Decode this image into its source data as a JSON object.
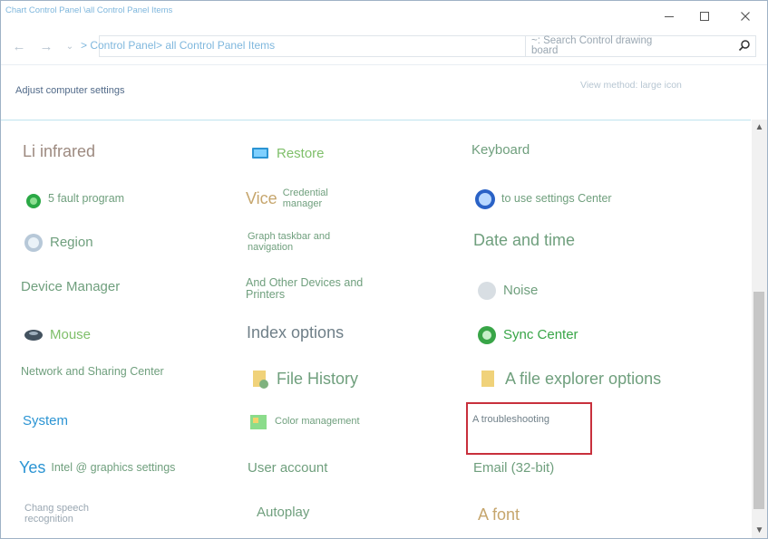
{
  "window": {
    "title": "Chart Control Panel \\all Control Panel Items"
  },
  "nav": {
    "address": "> Control Panel> all Control Panel Items",
    "search_placeholder": "~: Search Control drawing board"
  },
  "header": {
    "left": "Adjust computer settings",
    "right": "View method: large icon"
  },
  "items": [
    {
      "label": "Li infrared",
      "color": "#9d8a80",
      "size": "lg",
      "icon": "infrared-icon"
    },
    {
      "label": "Restore",
      "color": "#7fbf6a",
      "size": "md",
      "icon": "restore-icon"
    },
    {
      "label": "Keyboard",
      "color": "#6f9f7d",
      "size": "md",
      "icon": "keyboard-icon"
    },
    {
      "label": "5 fault program",
      "color": "#6f9f7d",
      "size": "sm",
      "icon": "default-programs-icon"
    },
    {
      "label": "Vice",
      "color": "#c6a66d",
      "size": "lg",
      "icon": "credential-manager-icon"
    },
    {
      "label": "Credential manager",
      "color": "#6f9f7d",
      "size": "xs",
      "icon": "credential-manager-icon"
    },
    {
      "label": "to use settings Center",
      "color": "#6f9f7d",
      "size": "sm",
      "icon": "ease-of-access-icon"
    },
    {
      "label": "Region",
      "color": "#6f9f7d",
      "size": "md",
      "icon": "region-icon"
    },
    {
      "label": "Graph taskbar and navigation",
      "color": "#6f9f7d",
      "size": "xs",
      "icon": "taskbar-icon"
    },
    {
      "label": "Date and time",
      "color": "#6f9f7d",
      "size": "lg",
      "icon": "date-time-icon"
    },
    {
      "label": "Device Manager",
      "color": "#6f9f7d",
      "size": "md",
      "icon": "device-manager-icon"
    },
    {
      "label": "And Other Devices and Printers",
      "color": "#6f9f7d",
      "size": "sm",
      "icon": "printers-icon"
    },
    {
      "label": "Noise",
      "color": "#6f9f7d",
      "size": "md",
      "icon": "sound-icon"
    },
    {
      "label": "Mouse",
      "color": "#7fbf6a",
      "size": "md",
      "icon": "mouse-icon"
    },
    {
      "label": "Index options",
      "color": "#6f7f88",
      "size": "lg",
      "icon": "index-options-icon"
    },
    {
      "label": "Sync Center",
      "color": "#38a547",
      "size": "md",
      "icon": "sync-center-icon"
    },
    {
      "label": "Network and Sharing Center",
      "color": "#6f9f7d",
      "size": "sm",
      "icon": "network-sharing-icon"
    },
    {
      "label": "File History",
      "color": "#6f9f7d",
      "size": "lg",
      "icon": "file-history-icon"
    },
    {
      "label": "A file explorer options",
      "color": "#6f9f7d",
      "size": "lg",
      "icon": "file-explorer-options-icon"
    },
    {
      "label": "System",
      "color": "#2b94d3",
      "size": "md",
      "icon": "system-icon"
    },
    {
      "label": "Color management",
      "color": "#6f9f7d",
      "size": "xs",
      "icon": "color-management-icon"
    },
    {
      "label": "A troubleshooting",
      "color": "#6f7f88",
      "size": "xs",
      "icon": "troubleshooting-icon"
    },
    {
      "label": "Yes",
      "color": "#2b94d3",
      "size": "lg",
      "icon": "intel-icon"
    },
    {
      "label": "Intel @ graphics settings",
      "color": "#6f9f7d",
      "size": "sm",
      "icon": "intel-graphics-icon"
    },
    {
      "label": "User account",
      "color": "#6f9f7d",
      "size": "md",
      "icon": "user-account-icon"
    },
    {
      "label": "Email (32-bit)",
      "color": "#6f9f7d",
      "size": "md",
      "icon": "email-icon"
    },
    {
      "label": "Chang speech recognition",
      "color": "#9aa7b2",
      "size": "xs",
      "icon": "speech-recognition-icon"
    },
    {
      "label": "Autoplay",
      "color": "#6f9f7d",
      "size": "md",
      "icon": "autoplay-icon"
    },
    {
      "label": "A font",
      "color": "#c6a66d",
      "size": "lg",
      "icon": "font-icon"
    }
  ]
}
